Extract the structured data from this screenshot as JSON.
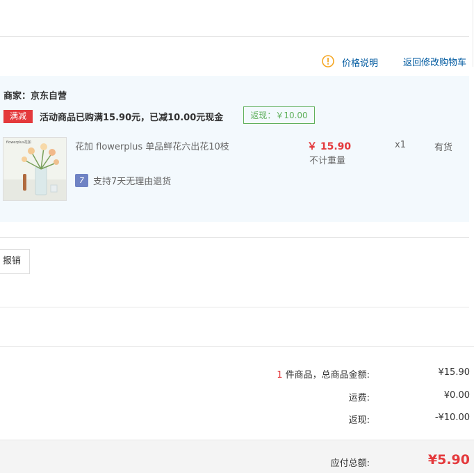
{
  "header": {
    "price_note_label": "价格说明",
    "back_to_cart_label": "返回修改购物车"
  },
  "shop": {
    "merchant_label": "商家：京东自营",
    "promo_tag": "满减",
    "promo_text": "活动商品已购满15.90元，已减10.00元现金",
    "rebate_text": "返现：￥10.00"
  },
  "item": {
    "image_caption": "flowerplus花加",
    "name": "花加 flowerplus 单品鲜花六出花10枝",
    "price": "￥ 15.90",
    "weight": "不计重量",
    "quantity": "x1",
    "stock": "有货",
    "return_policy": "支持7天无理由退货",
    "return_icon_text": "7"
  },
  "reimburse_button_label": "报销",
  "summary": {
    "count": "1",
    "count_suffix": " 件商品，总商品金额:",
    "total_goods_value": "¥15.90",
    "shipping_label": "运费:",
    "shipping_value": "¥0.00",
    "cashback_label": "返现:",
    "cashback_value": "-¥10.00",
    "payable_label": "应付总额:",
    "payable_value": "¥5.90"
  },
  "colors": {
    "accent_red": "#e4393c",
    "link_blue": "#005aa0",
    "rebate_green": "#5fb05c",
    "shop_bg": "#f3f9fd"
  }
}
